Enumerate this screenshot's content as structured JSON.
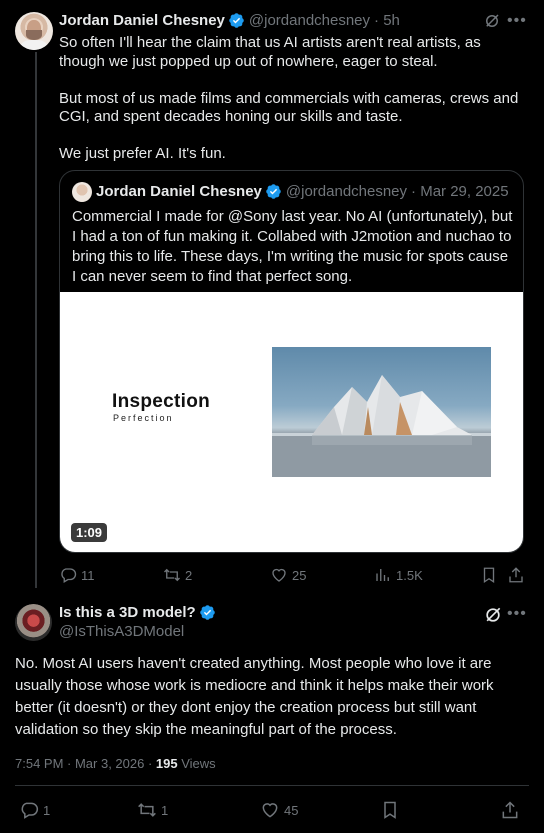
{
  "tweet1": {
    "author_name": "Jordan Daniel Chesney",
    "handle": "@jordandchesney",
    "time": "· 5h",
    "paragraphs": [
      "So often I'll hear the claim that us AI artists aren't real artists, as though we just popped up out of nowhere, eager to steal.",
      "But most of us made films and commercials with cameras, crews and CGI, and spent decades honing our skills and taste.",
      "We just prefer AI. It's fun."
    ],
    "quote": {
      "author_name": "Jordan Daniel Chesney",
      "handle": "@jordandchesney",
      "date": "· Mar 29, 2025",
      "text": "Commercial I made for @Sony last year. No AI (unfortunately), but I had a ton of fun making it. Collabed with J2motion and nuchao to bring this to life. These days, I'm writing the music for spots cause I can never seem to find that perfect song.",
      "video": {
        "title": "Inspection",
        "subtitle": "Perfection",
        "duration": "1:09"
      }
    },
    "actions": {
      "replies": "11",
      "reposts": "2",
      "likes": "25",
      "views": "1.5K"
    }
  },
  "tweet2": {
    "author_name": "Is this a 3D model?",
    "handle": "@IsThisA3DModel",
    "text": "No. Most AI users haven't created anything. Most people who love it are usually those whose work is mediocre and think it helps make their work better (it doesn't) or they dont enjoy the creation process but still want validation so they skip the meaningful part of the process.",
    "timestamp": "7:54 PM · Mar 3, 2026 · ",
    "views_count": "195",
    "views_label": " Views",
    "actions": {
      "replies": "1",
      "reposts": "1",
      "likes": "45"
    }
  },
  "colors": {
    "background": "#000000",
    "text": "#e7e9ea",
    "muted": "#71767b",
    "verified": "#1d9bf0",
    "border": "#2f3336"
  },
  "icons": [
    "verified-badge-icon",
    "grok-icon",
    "more-icon",
    "reply-icon",
    "repost-icon",
    "like-icon",
    "views-icon",
    "bookmark-icon",
    "share-icon"
  ]
}
